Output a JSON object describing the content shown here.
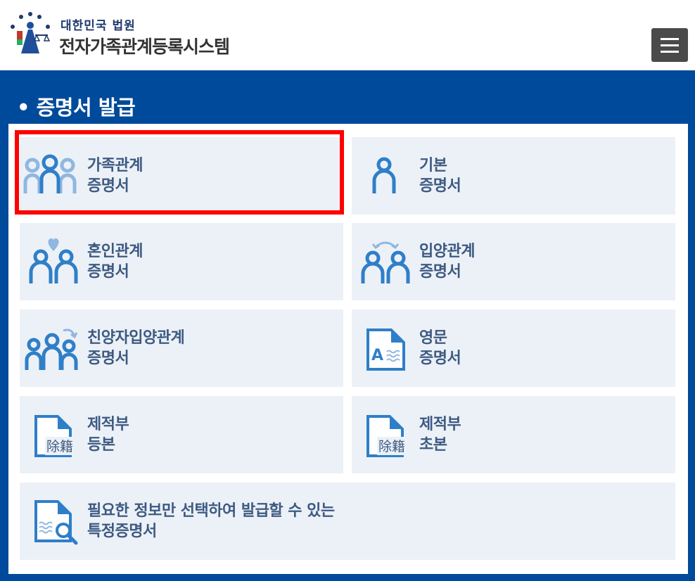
{
  "header": {
    "org_name": "대한민국 법원",
    "system_name": "전자가족관계등록시스템",
    "menu_icon": "hamburger-menu-icon"
  },
  "section": {
    "title": "• 증명서 발급"
  },
  "tiles": [
    {
      "line1": "가족관계",
      "line2": "증명서",
      "icon": "family-icon"
    },
    {
      "line1": "기본",
      "line2": "증명서",
      "icon": "person-icon"
    },
    {
      "line1": "혼인관계",
      "line2": "증명서",
      "icon": "couple-heart-icon"
    },
    {
      "line1": "입양관계",
      "line2": "증명서",
      "icon": "adoption-icon"
    },
    {
      "line1": "친양자입양관계",
      "line2": "증명서",
      "icon": "full-adoption-icon"
    },
    {
      "line1": "영문",
      "line2": "증명서",
      "icon": "english-document-icon"
    },
    {
      "line1": "제적부",
      "line2": "등본",
      "icon": "removed-register-document-icon",
      "stamp": "除籍"
    },
    {
      "line1": "제적부",
      "line2": "초본",
      "icon": "removed-register-document-icon",
      "stamp": "除籍"
    },
    {
      "line1": "필요한 정보만 선택하여 발급할 수 있는",
      "line2": "특정증명서",
      "icon": "document-search-icon"
    }
  ],
  "colors": {
    "brand_blue": "#004a9b",
    "tile_bg": "#ecf1f7",
    "icon_blue": "#2f7fc8",
    "icon_light": "#8fb7e0",
    "label": "#3d5a82",
    "highlight": "#ff0000"
  }
}
